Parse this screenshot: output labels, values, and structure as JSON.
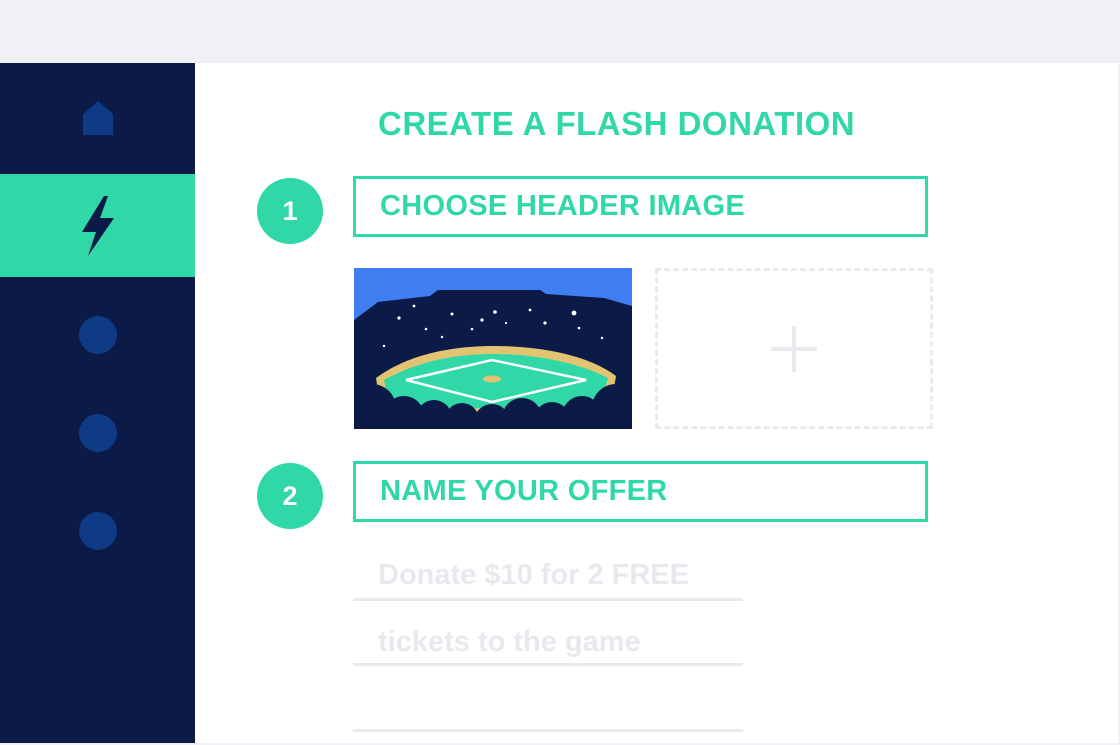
{
  "colors": {
    "accent": "#2fd8a6",
    "sidebar_bg": "#0c1a47",
    "sidebar_dot": "#0e3a86",
    "window_chrome": "#eff1f4",
    "placeholder_text": "#e6e9ee"
  },
  "sidebar": {
    "items": [
      {
        "icon": "home-icon",
        "active": false
      },
      {
        "icon": "lightning-bolt-icon",
        "active": true
      },
      {
        "icon": "circle-icon",
        "active": false
      },
      {
        "icon": "circle-icon",
        "active": false
      },
      {
        "icon": "circle-icon",
        "active": false
      }
    ]
  },
  "page": {
    "title": "CREATE A FLASH DONATION"
  },
  "steps": [
    {
      "number": "1",
      "label": "CHOOSE HEADER IMAGE"
    },
    {
      "number": "2",
      "label": "NAME YOUR OFFER"
    }
  ],
  "header_image": {
    "selected_icon": "baseball-stadium-image",
    "add_icon": "plus-icon"
  },
  "offer": {
    "lines": [
      "Donate $10 for 2 FREE",
      "tickets to the game",
      ""
    ]
  }
}
